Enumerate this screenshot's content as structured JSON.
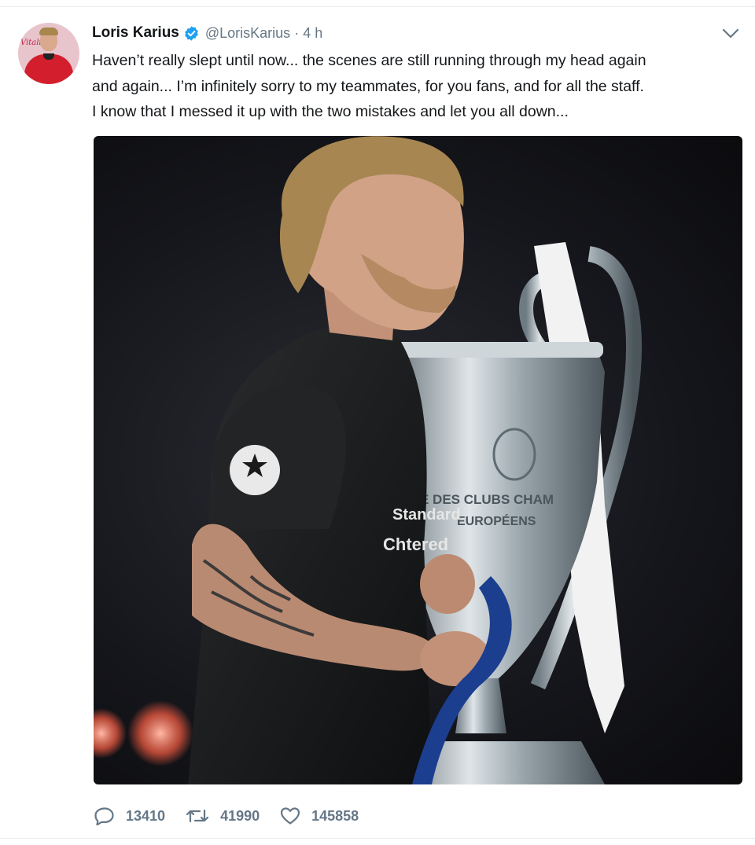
{
  "tweet": {
    "author": {
      "display_name": "Loris Karius",
      "handle": "@LorisKarius",
      "verified_icon": "verified-badge-icon",
      "avatar_logo_text": "Vitality"
    },
    "separator": "·",
    "time": "4 h",
    "text_lines": [
      "Haven’t really slept until now... the scenes are still running through my head again",
      "and again... I’m infinitely sorry to my teammates, for you fans, and for all the staff.",
      "I know that I messed it up with the two mistakes and let you all down..."
    ],
    "media": {
      "trophy_text_lines": [
        "E DES CLUBS CHAM",
        "EUROPÉENS"
      ],
      "sponsor_lines": [
        "Standard",
        "Chtered"
      ]
    },
    "actions": {
      "reply": {
        "icon": "reply-icon",
        "count": "13410"
      },
      "retweet": {
        "icon": "retweet-icon",
        "count": "41990"
      },
      "like": {
        "icon": "heart-icon",
        "count": "145858"
      }
    },
    "menu_icon": "chevron-down-icon"
  },
  "colors": {
    "text": "#14171a",
    "secondary": "#657786",
    "verified": "#1da1f2",
    "divider": "#e6ecf0"
  }
}
